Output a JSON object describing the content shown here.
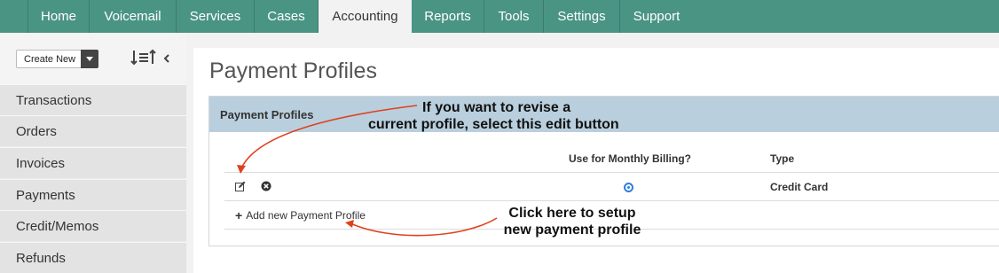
{
  "topnav": {
    "tabs": [
      {
        "label": "Home"
      },
      {
        "label": "Voicemail"
      },
      {
        "label": "Services"
      },
      {
        "label": "Cases"
      },
      {
        "label": "Accounting"
      },
      {
        "label": "Reports"
      },
      {
        "label": "Tools"
      },
      {
        "label": "Settings"
      },
      {
        "label": "Support"
      }
    ],
    "active": "Accounting"
  },
  "sidebar": {
    "create_new_label": "Create New",
    "items": [
      {
        "label": "Transactions"
      },
      {
        "label": "Orders"
      },
      {
        "label": "Invoices"
      },
      {
        "label": "Payments"
      },
      {
        "label": "Credit/Memos"
      },
      {
        "label": "Refunds"
      }
    ]
  },
  "main": {
    "page_title": "Payment Profiles",
    "card_title": "Payment Profiles",
    "columns": {
      "monthly_billing": "Use for Monthly Billing?",
      "type": "Type"
    },
    "rows": [
      {
        "monthly_billing": true,
        "type": "Credit Card"
      }
    ],
    "add_link_label": "Add new Payment Profile"
  },
  "annotations": {
    "edit_note_line1": "If you want to revise a",
    "edit_note_line2": "current profile, select this edit button",
    "add_note_line1": "Click here to setup",
    "add_note_line2": "new payment profile"
  },
  "colors": {
    "nav_green": "#4a9484",
    "card_header": "#b9cfdd",
    "arrow_red": "#e0401e",
    "radio_blue": "#2f7ed8"
  }
}
